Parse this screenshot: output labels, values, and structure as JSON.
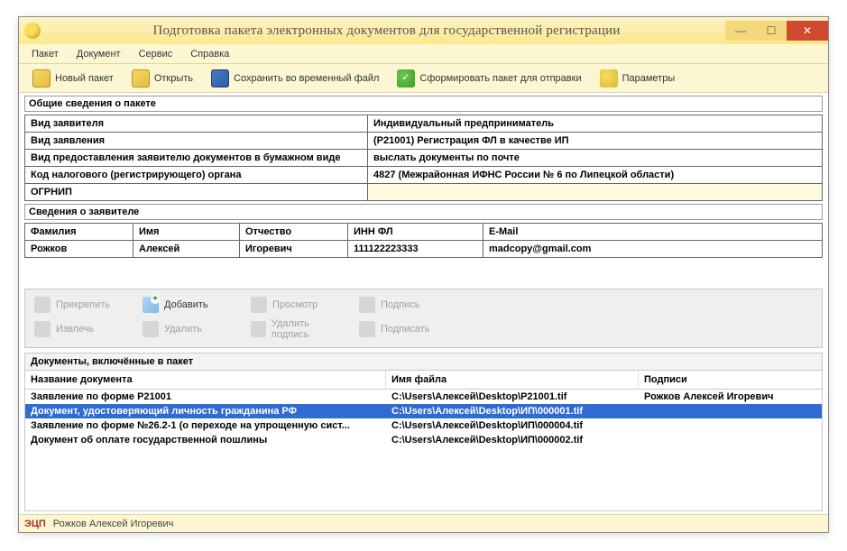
{
  "window": {
    "title": "Подготовка пакета электронных документов для государственной регистрации"
  },
  "menu": {
    "items": [
      "Пакет",
      "Документ",
      "Сервис",
      "Справка"
    ]
  },
  "toolbar": {
    "new": "Новый пакет",
    "open": "Открыть",
    "save": "Сохранить во временный файл",
    "build": "Сформировать пакет для отправки",
    "params": "Параметры"
  },
  "package": {
    "title": "Общие сведения о пакете",
    "rows": [
      {
        "label": "Вид заявителя",
        "value": "Индивидуальный предприниматель"
      },
      {
        "label": "Вид заявления",
        "value": "(Р21001) Регистрация ФЛ в качестве ИП"
      },
      {
        "label": "Вид предоставления заявителю документов в бумажном виде",
        "value": "выслать документы по почте"
      },
      {
        "label": "Код налогового (регистрирующего) органа",
        "value": "4827 (Межрайонная ИФНС России № 6 по Липецкой области)"
      },
      {
        "label": "ОГРНИП",
        "value": ""
      }
    ]
  },
  "applicant": {
    "title": "Сведения о заявителе",
    "headers": {
      "fam": "Фамилия",
      "name": "Имя",
      "patr": "Отчество",
      "inn": "ИНН ФЛ",
      "email": "E-Mail"
    },
    "row": {
      "fam": "Рожков",
      "name": "Алексей",
      "patr": "Игоревич",
      "inn": "111122223333",
      "email": "madcopy@gmail.com"
    }
  },
  "doctools": {
    "attach": "Прикрепить",
    "add": "Добавить",
    "view": "Просмотр",
    "sign": "Подпись",
    "extract": "Извлечь",
    "remove": "Удалить",
    "rmsign": "Удалить подпись",
    "dosign": "Подписать"
  },
  "docs": {
    "title": "Документы, включённые в пакет",
    "headers": {
      "name": "Название документа",
      "file": "Имя файла",
      "sign": "Подписи"
    },
    "rows": [
      {
        "name": "Заявление по форме Р21001",
        "file": "C:\\Users\\Алексей\\Desktop\\P21001.tif",
        "sign": "Рожков Алексей Игоревич",
        "sel": false
      },
      {
        "name": "Документ, удостоверяющий личность гражданина РФ",
        "file": "C:\\Users\\Алексей\\Desktop\\ИП\\000001.tif",
        "sign": "",
        "sel": true
      },
      {
        "name": "Заявление по форме №26.2-1 (о переходе на упрощенную сист...",
        "file": "C:\\Users\\Алексей\\Desktop\\ИП\\000004.tif",
        "sign": "",
        "sel": false
      },
      {
        "name": "Документ об оплате государственной пошлины",
        "file": "C:\\Users\\Алексей\\Desktop\\ИП\\000002.tif",
        "sign": "",
        "sel": false
      }
    ]
  },
  "status": {
    "ecp": "ЭЦП",
    "name": "Рожков Алексей Игоревич"
  }
}
